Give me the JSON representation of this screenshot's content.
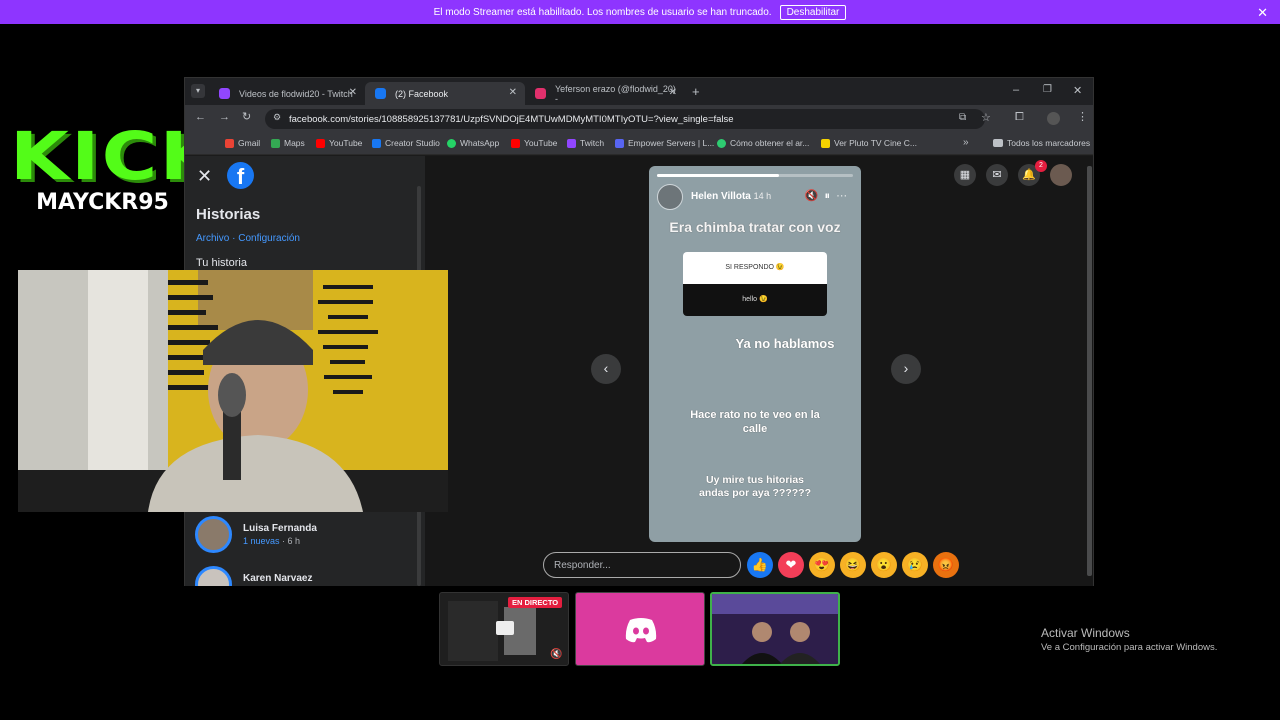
{
  "streamer_bar": {
    "message": "El modo Streamer está habilitado. Los nombres de usuario se han truncado.",
    "button": "Deshabilitar",
    "close": "✕"
  },
  "overlay": {
    "logo": "KICK",
    "username": "MAYCKR95"
  },
  "browser": {
    "tabs": [
      {
        "label": "Videos de flodwid20 - Twitch",
        "color": "#9146ff"
      },
      {
        "label": "(2) Facebook",
        "color": "#1877f2"
      },
      {
        "label": "Yeferson erazo (@flodwid_20) -",
        "color": "#e1306c"
      }
    ],
    "url": "facebook.com/stories/108858925137781/UzpfSVNDOjE4MTUwMDMyMTI0MTIyOTU=?view_single=false",
    "bookmarks": [
      {
        "label": "Gmail",
        "color": "#ea4335"
      },
      {
        "label": "Maps",
        "color": "#34a853"
      },
      {
        "label": "YouTube",
        "color": "#ff0000"
      },
      {
        "label": "Creator Studio",
        "color": "#1877f2"
      },
      {
        "label": "WhatsApp",
        "color": "#25d366"
      },
      {
        "label": "YouTube",
        "color": "#ff0000"
      },
      {
        "label": "Twitch",
        "color": "#9146ff"
      },
      {
        "label": "Empower Servers | L...",
        "color": "#5865f2"
      },
      {
        "label": "Cómo obtener el ar...",
        "color": "#2ecc71"
      },
      {
        "label": "Ver Pluto TV Cine C...",
        "color": "#f5d300"
      }
    ],
    "all_bookmarks": "Todos los marcadores"
  },
  "sidebar": {
    "title": "Historias",
    "links": "Archivo · Configuración",
    "your_story": "Tu historia",
    "contacts": [
      {
        "name": "Luisa Fernanda",
        "new": "1 nuevas",
        "time": " · 6 h"
      },
      {
        "name": "Karen Narvaez",
        "new": "",
        "time": ""
      }
    ]
  },
  "story": {
    "author": "Helen Villota",
    "time": "14 h",
    "headline": "Era chimba tratar con voz",
    "poll_question": "SI RESPONDO 😉",
    "poll_answer": "hello 😉",
    "line1": "Ya no hablamos",
    "line2": "Hace rato no te veo en la calle",
    "line3": "Uy mire tus hitorias andas por aya ??????",
    "progress": 0.62
  },
  "reply": {
    "placeholder": "Responder...",
    "reactions": [
      "👍",
      "❤",
      "😍",
      "😆",
      "😮",
      "😢",
      "😡"
    ]
  },
  "notifications": {
    "count": "2"
  },
  "thumbnails": {
    "live_label": "EN DIRECTO"
  },
  "windows": {
    "activate_title": "Activar Windows",
    "activate_sub": "Ve a Configuración para activar Windows."
  }
}
